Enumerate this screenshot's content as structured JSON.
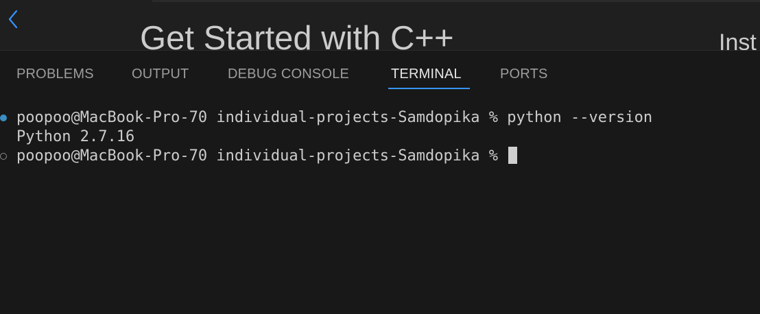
{
  "editor": {
    "title": "Get Started with C++",
    "side_text": "Inst"
  },
  "panel": {
    "tabs": [
      {
        "label": "PROBLEMS"
      },
      {
        "label": "OUTPUT"
      },
      {
        "label": "DEBUG CONSOLE"
      },
      {
        "label": "TERMINAL"
      },
      {
        "label": "PORTS"
      }
    ],
    "active_tab": "TERMINAL",
    "accent_color": "#3794ff"
  },
  "terminal": {
    "lines": [
      {
        "text": "poopoo@MacBook-Pro-70 individual-projects-Samdopika % python --version",
        "decoration": "success"
      },
      {
        "text": "Python 2.7.16",
        "decoration": "none"
      },
      {
        "text": "poopoo@MacBook-Pro-70 individual-projects-Samdopika % ",
        "decoration": "default"
      }
    ],
    "decoration_success_color": "#3a8fc4"
  },
  "icons": {
    "back": "chevron-left-icon"
  }
}
